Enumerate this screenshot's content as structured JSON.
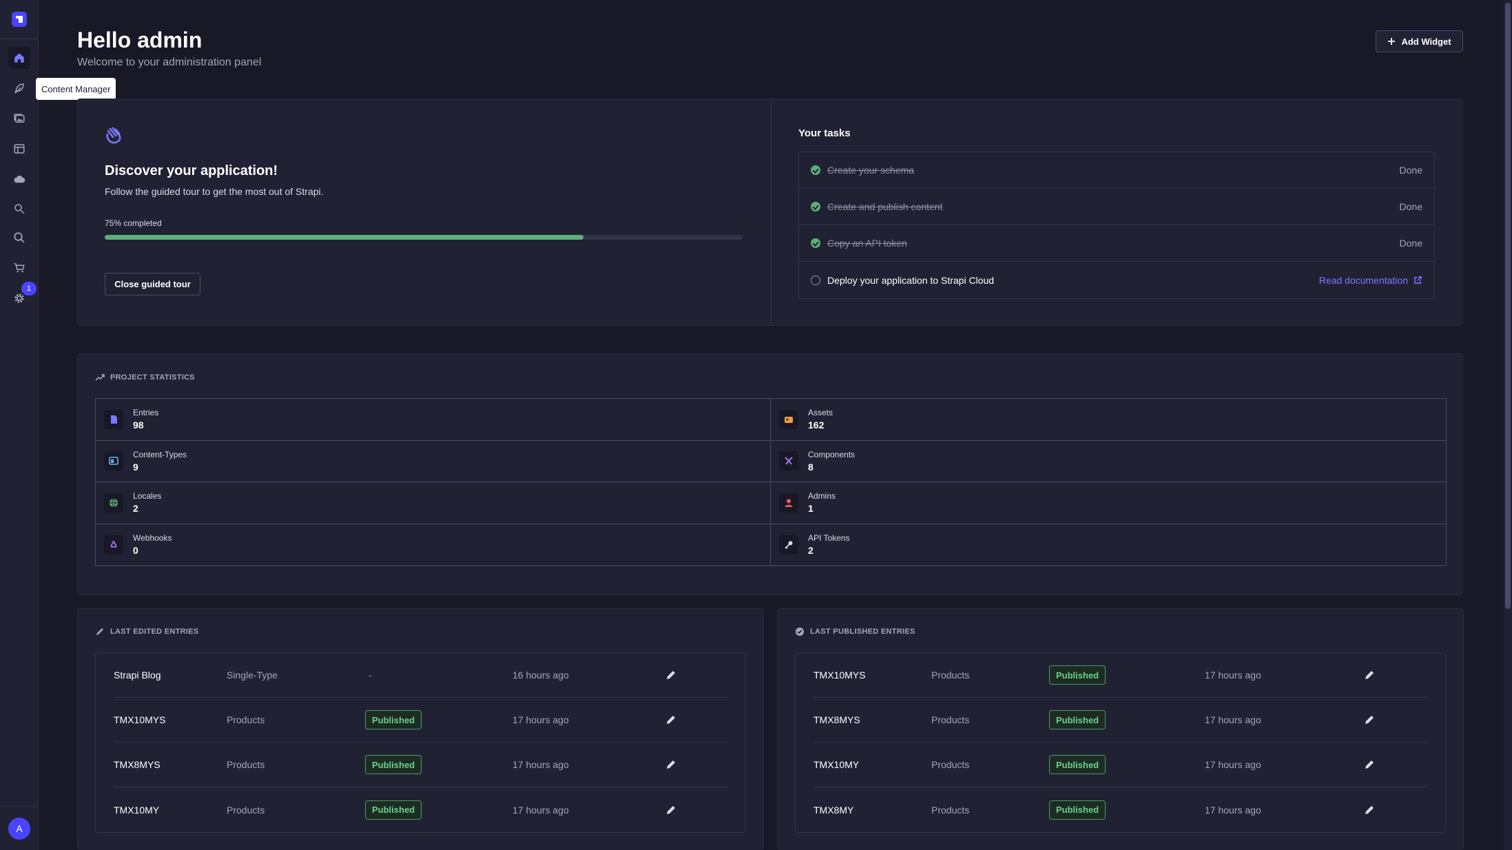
{
  "sidebar": {
    "tooltip": "Content Manager",
    "settings_badge": "1",
    "avatar_initial": "A"
  },
  "header": {
    "title": "Hello admin",
    "subtitle": "Welcome to your administration panel",
    "add_widget_label": "Add Widget"
  },
  "tour": {
    "title": "Discover your application!",
    "description": "Follow the guided tour to get the most out of Strapi.",
    "progress_label": "75% completed",
    "progress_percent": 75,
    "close_label": "Close guided tour"
  },
  "tasks": {
    "title": "Your tasks",
    "items": [
      {
        "label": "Create your schema",
        "status": "Done"
      },
      {
        "label": "Create and publish content",
        "status": "Done"
      },
      {
        "label": "Copy an API token",
        "status": "Done"
      },
      {
        "label": "Deploy your application to Strapi Cloud",
        "link": "Read documentation"
      }
    ]
  },
  "stats": {
    "title": "PROJECT STATISTICS",
    "items": [
      {
        "label": "Entries",
        "value": "98",
        "icon": "entries-icon",
        "color": "#7b79ff"
      },
      {
        "label": "Assets",
        "value": "162",
        "icon": "assets-icon",
        "color": "#f29d41"
      },
      {
        "label": "Content-Types",
        "value": "9",
        "icon": "content-types-icon",
        "color": "#66b7f1"
      },
      {
        "label": "Components",
        "value": "8",
        "icon": "components-icon",
        "color": "#ac73e6"
      },
      {
        "label": "Locales",
        "value": "2",
        "icon": "globe-icon",
        "color": "#5cb176"
      },
      {
        "label": "Admins",
        "value": "1",
        "icon": "user-icon",
        "color": "#ee5e52"
      },
      {
        "label": "Webhooks",
        "value": "0",
        "icon": "webhooks-icon",
        "color": "#ac73e6"
      },
      {
        "label": "API Tokens",
        "value": "2",
        "icon": "key-icon",
        "color": "#dcdce4"
      }
    ]
  },
  "last_edited": {
    "title": "LAST EDITED ENTRIES",
    "rows": [
      {
        "title": "Strapi Blog",
        "type": "Single-Type",
        "status": "-",
        "time": "16 hours ago"
      },
      {
        "title": "TMX10MYS",
        "type": "Products",
        "status": "Published",
        "time": "17 hours ago"
      },
      {
        "title": "TMX8MYS",
        "type": "Products",
        "status": "Published",
        "time": "17 hours ago"
      },
      {
        "title": "TMX10MY",
        "type": "Products",
        "status": "Published",
        "time": "17 hours ago"
      }
    ]
  },
  "last_published": {
    "title": "LAST PUBLISHED ENTRIES",
    "rows": [
      {
        "title": "TMX10MYS",
        "type": "Products",
        "status": "Published",
        "time": "17 hours ago"
      },
      {
        "title": "TMX8MYS",
        "type": "Products",
        "status": "Published",
        "time": "17 hours ago"
      },
      {
        "title": "TMX10MY",
        "type": "Products",
        "status": "Published",
        "time": "17 hours ago"
      },
      {
        "title": "TMX8MY",
        "type": "Products",
        "status": "Published",
        "time": "17 hours ago"
      }
    ]
  },
  "colors": {
    "accent": "#4945ff",
    "success": "#5cb176",
    "link": "#7b79ff",
    "background": "#181826",
    "surface": "#212134"
  }
}
